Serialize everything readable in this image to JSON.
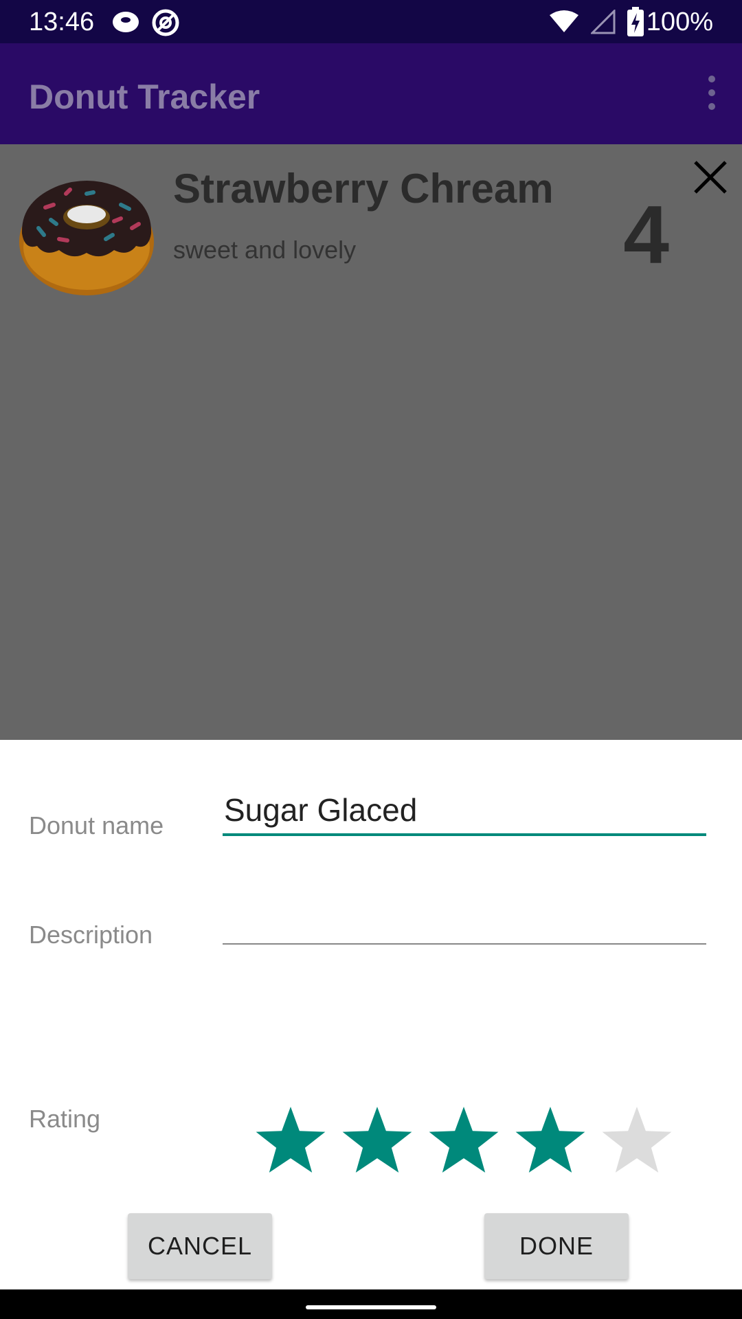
{
  "status_bar": {
    "time": "13:46",
    "battery_text": "100%",
    "icons": [
      "donut-notification-icon",
      "sync-icon",
      "wifi-icon",
      "signal-icon",
      "battery-charging-icon"
    ]
  },
  "app_bar": {
    "title": "Donut Tracker",
    "menu_icon": "more-vert-icon"
  },
  "donut_item": {
    "name": "Strawberry Chream",
    "description": "sweet and lovely",
    "rating": "4"
  },
  "dialog": {
    "name_label": "Donut name",
    "name_value": "Sugar Glaced",
    "description_label": "Description",
    "description_value": "",
    "rating_label": "Rating",
    "rating_value": 4,
    "rating_max": 5,
    "cancel_label": "CANCEL",
    "done_label": "DONE"
  },
  "colors": {
    "status_bar": "#130646",
    "app_bar": "#2a0a66",
    "accent": "#00897b",
    "star_empty": "#dcdcdc",
    "scrim": "#666666"
  }
}
